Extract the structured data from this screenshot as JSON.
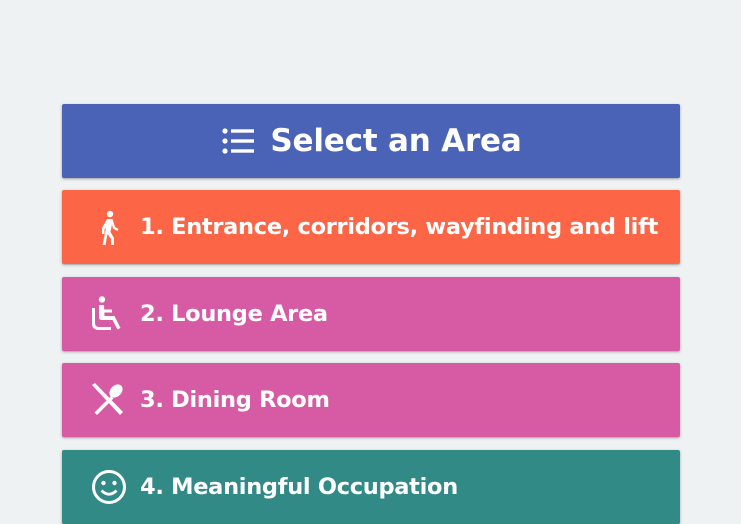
{
  "header": {
    "title": "Select an Area",
    "icon": "list-icon",
    "color": "#4b63b6"
  },
  "areas": [
    {
      "label": "1. Entrance, corridors, wayfinding and lift",
      "icon": "walking-person-icon",
      "color": "#fc6545"
    },
    {
      "label": "2. Lounge Area",
      "icon": "seated-person-icon",
      "color": "#d65ba4"
    },
    {
      "label": "3. Dining Room",
      "icon": "cutlery-icon",
      "color": "#d65ba4"
    },
    {
      "label": "4. Meaningful Occupation",
      "icon": "smiley-face-icon",
      "color": "#318a86"
    }
  ]
}
